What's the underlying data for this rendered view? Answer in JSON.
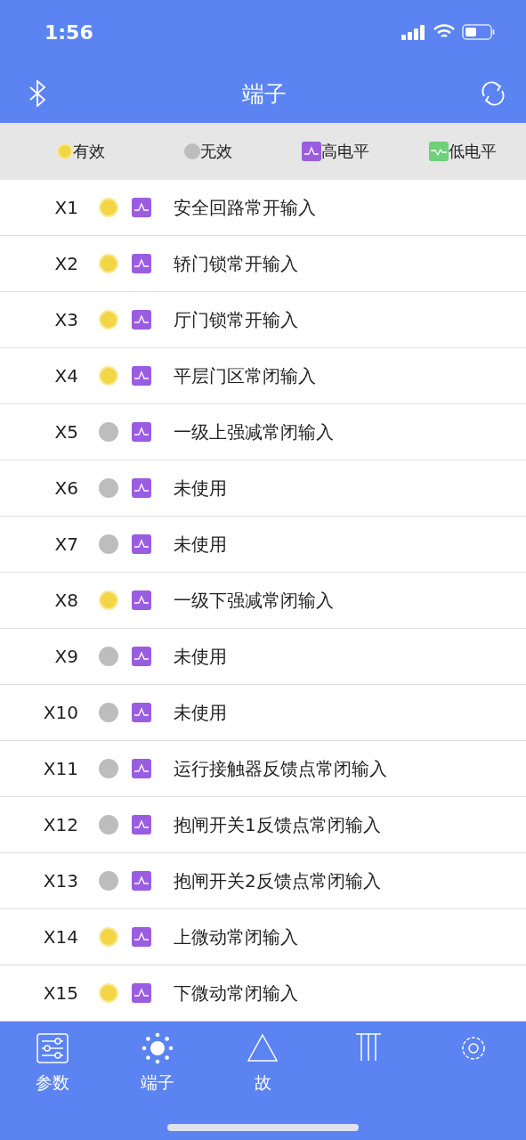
{
  "status_bar": {
    "time": "1:56"
  },
  "nav": {
    "title": "端子"
  },
  "legend": [
    {
      "kind": "valid",
      "label": "有效"
    },
    {
      "kind": "invalid",
      "label": "无效"
    },
    {
      "kind": "high",
      "label": "高电平"
    },
    {
      "kind": "low",
      "label": "低电平"
    }
  ],
  "rows": [
    {
      "terminal": "X1",
      "valid": true,
      "kind": "high",
      "name": "安全回路常开输入"
    },
    {
      "terminal": "X2",
      "valid": true,
      "kind": "high",
      "name": "轿门锁常开输入"
    },
    {
      "terminal": "X3",
      "valid": true,
      "kind": "high",
      "name": "厅门锁常开输入"
    },
    {
      "terminal": "X4",
      "valid": true,
      "kind": "high",
      "name": "平层门区常闭输入"
    },
    {
      "terminal": "X5",
      "valid": false,
      "kind": "high",
      "name": "一级上强减常闭输入"
    },
    {
      "terminal": "X6",
      "valid": false,
      "kind": "high",
      "name": "未使用"
    },
    {
      "terminal": "X7",
      "valid": false,
      "kind": "high",
      "name": "未使用"
    },
    {
      "terminal": "X8",
      "valid": true,
      "kind": "high",
      "name": "一级下强减常闭输入"
    },
    {
      "terminal": "X9",
      "valid": false,
      "kind": "high",
      "name": "未使用"
    },
    {
      "terminal": "X10",
      "valid": false,
      "kind": "high",
      "name": "未使用"
    },
    {
      "terminal": "X11",
      "valid": false,
      "kind": "high",
      "name": "运行接触器反馈点常闭输入"
    },
    {
      "terminal": "X12",
      "valid": false,
      "kind": "high",
      "name": "抱闸开关1反馈点常闭输入"
    },
    {
      "terminal": "X13",
      "valid": false,
      "kind": "high",
      "name": "抱闸开关2反馈点常闭输入"
    },
    {
      "terminal": "X14",
      "valid": true,
      "kind": "high",
      "name": "上微动常闭输入"
    },
    {
      "terminal": "X15",
      "valid": true,
      "kind": "high",
      "name": "下微动常闭输入"
    }
  ],
  "tab_bar": [
    {
      "kind": "sliders",
      "label": "参数"
    },
    {
      "kind": "sun",
      "label": "端子"
    },
    {
      "kind": "triangle",
      "label": "故"
    },
    {
      "kind": "columns"
    },
    {
      "kind": "gear"
    }
  ]
}
